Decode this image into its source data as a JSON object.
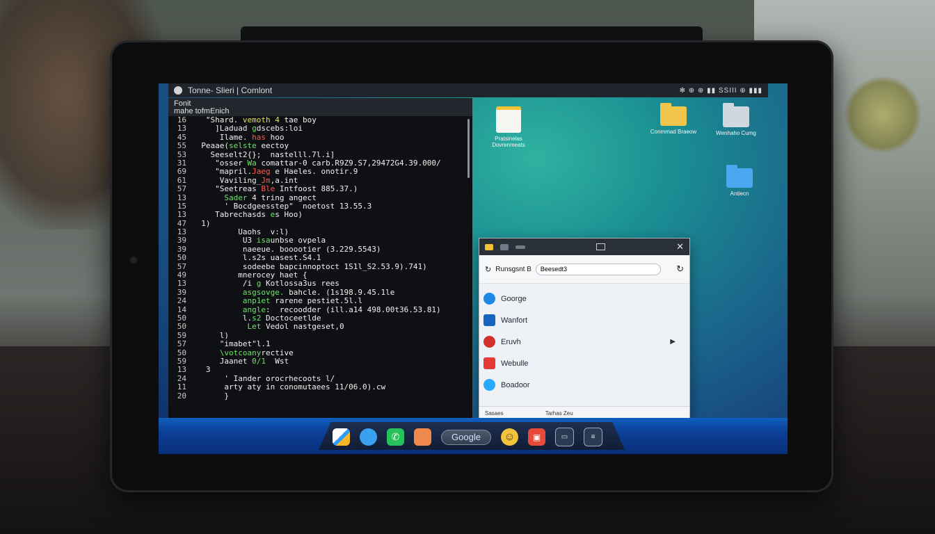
{
  "topbar": {
    "title": "Tonne- Slieri | Comlont",
    "status": "✻ ⊕ ⊕ ▮▮ SSIII ⊕ ▮▮▮"
  },
  "editor": {
    "head_line1": "Fonit",
    "head_line2": "mahe tofmEnich",
    "lines": [
      {
        "n": "16",
        "pre": "   \"Shard. ",
        "hl": "vemoth 4 ",
        "c": "y",
        "post": "tae boy"
      },
      {
        "n": "13",
        "pre": "     ]Laduad ",
        "hl": "g",
        "c": "g",
        "post": "dscebs:loi"
      },
      {
        "n": "45",
        "pre": "      Ilame. ",
        "hl": "has",
        "c": "r",
        "post": " hoo"
      },
      {
        "n": "55",
        "pre": "  Peaae(",
        "hl": "selste",
        "c": "g",
        "post": " eectoy"
      },
      {
        "n": "53",
        "pre": "    Seeselt2{};  nastelll.7l.i]",
        "hl": "",
        "c": "g",
        "post": ""
      },
      {
        "n": "31",
        "pre": "     \"osser ",
        "hl": "Wa",
        "c": "g",
        "post": " comattar-0 carb.R9Z9.S7,29472G4.39.000/"
      },
      {
        "n": "69",
        "pre": "     \"mapril.",
        "hl": "Jaeg",
        "c": "r",
        "post": " e Haeles. onotir.9"
      },
      {
        "n": "61",
        "pre": "      Vaviling_",
        "hl": "Jm",
        "c": "r",
        "post": ",a.int"
      },
      {
        "n": "57",
        "pre": "     \"Seetreas ",
        "hl": "Ble",
        "c": "r",
        "post": " Intfoost 885.37.)"
      },
      {
        "n": "13",
        "pre": "       ",
        "hl": "Sader",
        "c": "g",
        "post": " 4 tring angect"
      },
      {
        "n": "15",
        "pre": "       ' Bocdgeesstep\"  noetost 13.55.3",
        "hl": "",
        "c": "g",
        "post": ""
      },
      {
        "n": "13",
        "pre": "     Tabrechasds ",
        "hl": "e",
        "c": "g",
        "post": "s Hoo)"
      },
      {
        "n": "47",
        "pre": "  1)",
        "hl": "",
        "c": "g",
        "post": ""
      },
      {
        "n": "13",
        "pre": "          Uaohs  v:l)",
        "hl": "",
        "c": "g",
        "post": ""
      },
      {
        "n": "39",
        "pre": "           U3 ",
        "hl": "isa",
        "c": "g",
        "post": "unbse ovpela"
      },
      {
        "n": "39",
        "pre": "           naeeue. booootier (3.229.5543)",
        "hl": "",
        "c": "g",
        "post": ""
      },
      {
        "n": "50",
        "pre": "           l.s2s",
        "hl": "",
        "c": "g",
        "post": " uasest.S4.1"
      },
      {
        "n": "57",
        "pre": "           sodeebe bapcinnoptoct 1S1l_S2.53.9).741)",
        "hl": "",
        "c": "g",
        "post": ""
      },
      {
        "n": "49",
        "pre": "          mnerocey haet {",
        "hl": "",
        "c": "g",
        "post": ""
      },
      {
        "n": "13",
        "pre": "           /i",
        "hl": " g ",
        "c": "g",
        "post": "Kotlossa3us rees"
      },
      {
        "n": "39",
        "pre": "           ",
        "hl": "asgsovge.",
        "c": "g",
        "post": " bahcle. (1s198.9.45.1le"
      },
      {
        "n": "24",
        "pre": "           ",
        "hl": "anp1et",
        "c": "g",
        "post": " rarene pestiet.5l.l"
      },
      {
        "n": "14",
        "pre": "           ",
        "hl": "angle",
        "c": "g",
        "post": ":  recoodder (ill.a14 498.00t36.53.81)"
      },
      {
        "n": "50",
        "pre": "           l.",
        "hl": "s2",
        "c": "g",
        "post": " Doctoceetlde"
      },
      {
        "n": "50",
        "pre": "            ",
        "hl": "Let",
        "c": "g",
        "post": " Vedol nastgeset,0"
      },
      {
        "n": "59",
        "pre": "      l)",
        "hl": "",
        "c": "g",
        "post": ""
      },
      {
        "n": "57",
        "pre": "      \"imabet\"l.1",
        "hl": "",
        "c": "g",
        "post": ""
      },
      {
        "n": "50",
        "pre": "      ",
        "hl": "\\votcoany",
        "c": "g",
        "post": "rective"
      },
      {
        "n": "59",
        "pre": "      Jaanet ",
        "hl": "0/1",
        "c": "g",
        "post": "  Wst"
      },
      {
        "n": "13",
        "pre": "   3",
        "hl": "",
        "c": "g",
        "post": ""
      },
      {
        "n": "24",
        "pre": "       ' Iander orocrhecoots l/",
        "hl": "",
        "c": "g",
        "post": ""
      },
      {
        "n": "11",
        "pre": "       arty aty in conomutaees 11/06.0).cw",
        "hl": "",
        "c": "g",
        "post": ""
      },
      {
        "n": "20",
        "pre": "       }",
        "hl": "",
        "c": "g",
        "post": ""
      }
    ]
  },
  "desktop_icons": [
    {
      "name": "desktop-icon-document",
      "label": "Pratsinelas Dovrenmeats",
      "kind": "doc"
    },
    {
      "name": "desktop-icon-folder-yellow",
      "label": "Conmmad Braeow",
      "kind": "folder",
      "color": "#f0c64a"
    },
    {
      "name": "desktop-icon-folder-grey",
      "label": "Wenhaho Cumg",
      "kind": "folderg",
      "color": "#cfd8e0"
    },
    {
      "name": "desktop-icon-folder-blue",
      "label": "Antiecn",
      "kind": "folder",
      "color": "#4aa8f0"
    }
  ],
  "dialog": {
    "search_label": "Runsgsnt  B",
    "search_value": "Beesedt3",
    "items": [
      {
        "label": "Goorge",
        "icon_color": "#1e88e5",
        "arrow": ""
      },
      {
        "label": "Wanfort",
        "icon_color": "#1565c0",
        "arrow": ""
      },
      {
        "label": "Eruvh",
        "icon_color": "#d32f2f",
        "arrow": "▶"
      },
      {
        "label": "Webulle",
        "icon_color": "#e53935",
        "arrow": ""
      },
      {
        "label": "Boadoor",
        "icon_color": "#29a8ff",
        "arrow": ""
      }
    ],
    "footer_left": "Sasaes",
    "footer_right": "Tarhas Zeu"
  },
  "taskbar": {
    "search_label": "Google"
  },
  "colors": {
    "accent": "#1e88e5",
    "code_green": "#6fe36a",
    "code_red": "#ff5a48"
  }
}
